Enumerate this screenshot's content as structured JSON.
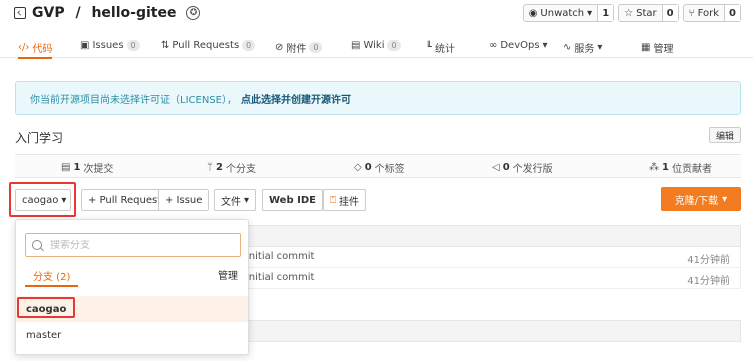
{
  "repo": {
    "owner": "GVP",
    "separator": " / ",
    "name": "hello-gitee",
    "icon": "repo-icon",
    "medal_icon": "medal-icon"
  },
  "actions": {
    "watch": {
      "label": "Unwatch",
      "count": "1",
      "icon": "eye-icon"
    },
    "star": {
      "label": "Star",
      "count": "0",
      "icon": "star-icon"
    },
    "fork": {
      "label": "Fork",
      "count": "0",
      "icon": "fork-icon"
    }
  },
  "nav": {
    "code": "代码",
    "issues": {
      "label": "Issues",
      "count": "0"
    },
    "pulls": {
      "label": "Pull Requests",
      "count": "0"
    },
    "attachments": {
      "label": "附件",
      "count": "0"
    },
    "wiki": {
      "label": "Wiki",
      "count": "0"
    },
    "stats": "统计",
    "devops": "DevOps",
    "service": "服务",
    "manage": "管理"
  },
  "notice": {
    "text": "你当前开源项目尚未选择许可证（LICENSE），",
    "link": "点此选择并创建开源许可"
  },
  "section": {
    "title": "入门学习",
    "edit": "编辑"
  },
  "stats": {
    "commits": {
      "count": "1",
      "label": "次提交"
    },
    "branches": {
      "count": "2",
      "label": "个分支"
    },
    "tags": {
      "count": "0",
      "label": "个标签"
    },
    "releases": {
      "count": "0",
      "label": "个发行版"
    },
    "contributors": {
      "count": "1",
      "label": "位贡献者"
    }
  },
  "toolbar": {
    "branch": "caogao",
    "pull_request": "+ Pull Request",
    "issue": "+ Issue",
    "file": "文件",
    "web_ide": "Web IDE",
    "hang": "挂件",
    "clone": "克隆/下载"
  },
  "files": [
    {
      "message": "initial commit",
      "time": "41分钟前"
    },
    {
      "message": "initial commit",
      "time": "41分钟前"
    }
  ],
  "dropdown": {
    "search_placeholder": "搜索分支",
    "tab": "分支 (2)",
    "manage": "管理",
    "branches": [
      "caogao",
      "master"
    ]
  },
  "colors": {
    "accent": "#e8670c",
    "clone": "#f37b20",
    "highlight": "#e53935",
    "notice_bg": "#eaf8fb"
  }
}
